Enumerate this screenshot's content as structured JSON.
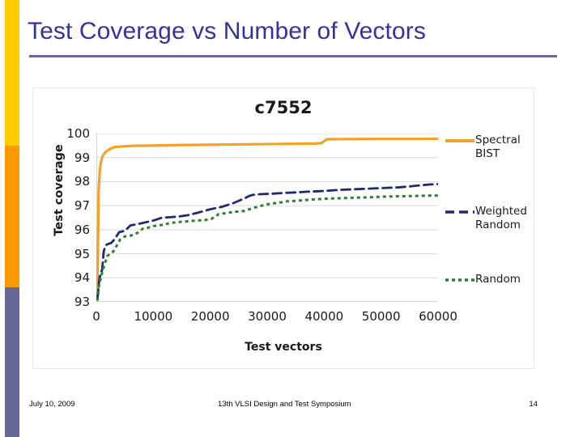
{
  "slide": {
    "title": "Test Coverage vs Number of Vectors",
    "accent_yellow": "#FFCC00",
    "accent_orange": "#FF9900",
    "accent_purple": "#666699",
    "title_color": "#333399"
  },
  "footer": {
    "date": "July 10, 2009",
    "event": "13th VLSI Design and Test Symposium",
    "page_number": "14"
  },
  "chart_data": {
    "type": "line",
    "title": "c7552",
    "xlabel": "Test vectors",
    "ylabel": "Test coverage",
    "xlim": [
      0,
      60000
    ],
    "ylim": [
      93,
      100
    ],
    "xticks": [
      0,
      10000,
      20000,
      30000,
      40000,
      50000,
      60000
    ],
    "xtick_labels": [
      "0",
      "10000",
      "20000",
      "30000",
      "40000",
      "50000",
      "60000"
    ],
    "yticks": [
      93,
      94,
      95,
      96,
      97,
      98,
      99,
      100
    ],
    "ytick_labels": [
      "93",
      "94",
      "95",
      "96",
      "97",
      "98",
      "99",
      "100"
    ],
    "grid": "horizontal",
    "legend_position": "right",
    "series": [
      {
        "name": "Spectral BIST",
        "legend_label": "Spectral\nBIST",
        "color": "#F0A22E",
        "style": "solid",
        "x": [
          0,
          200,
          400,
          600,
          800,
          1000,
          1200,
          1500,
          2000,
          2600,
          3200,
          4000,
          5000,
          7000,
          10000,
          14000,
          18000,
          22000,
          26000,
          30000,
          34000,
          38000,
          39500,
          40500,
          44000,
          50000,
          56000,
          60000
        ],
        "y": [
          93.05,
          93.6,
          97.6,
          98.45,
          98.8,
          99.0,
          99.1,
          99.2,
          99.3,
          99.38,
          99.44,
          99.45,
          99.47,
          99.49,
          99.5,
          99.52,
          99.53,
          99.54,
          99.55,
          99.56,
          99.57,
          99.58,
          99.6,
          99.76,
          99.77,
          99.78,
          99.78,
          99.78
        ]
      },
      {
        "name": "Weighted Random",
        "legend_label": "Weighted\nRandom",
        "color": "#1F2A6E",
        "style": "dashed",
        "x": [
          200,
          500,
          800,
          1000,
          1300,
          1600,
          2000,
          2600,
          3200,
          4000,
          5000,
          6000,
          7000,
          8500,
          10000,
          11500,
          13000,
          14500,
          16000,
          18000,
          20000,
          22000,
          24000,
          26000,
          26800,
          27500,
          29000,
          31000,
          33000,
          35000,
          37000,
          39000,
          41000,
          43000,
          45000,
          47000,
          49000,
          51000,
          53000,
          55000,
          57000,
          58500,
          60000
        ],
        "y": [
          93.15,
          93.9,
          94.25,
          94.3,
          95.1,
          95.35,
          95.4,
          95.45,
          95.6,
          95.9,
          95.95,
          96.18,
          96.22,
          96.3,
          96.38,
          96.5,
          96.52,
          96.55,
          96.6,
          96.72,
          96.85,
          96.95,
          97.1,
          97.3,
          97.4,
          97.45,
          97.48,
          97.5,
          97.53,
          97.55,
          97.58,
          97.6,
          97.63,
          97.66,
          97.68,
          97.7,
          97.72,
          97.74,
          97.76,
          97.8,
          97.85,
          97.88,
          97.9
        ]
      },
      {
        "name": "Random",
        "legend_label": "Random",
        "color": "#2E7D32",
        "style": "dotted",
        "x": [
          200,
          500,
          800,
          1100,
          1500,
          1900,
          2400,
          3000,
          3600,
          4200,
          5000,
          5800,
          6600,
          7400,
          8200,
          9000,
          10000,
          11500,
          13000,
          14500,
          16000,
          17500,
          19000,
          20200,
          21500,
          23000,
          24500,
          26000,
          27500,
          29000,
          30500,
          32000,
          33500,
          35000,
          37000,
          39000,
          41000,
          43000,
          45000,
          47000,
          49000,
          51000,
          53000,
          55000,
          57000,
          58500,
          60000
        ],
        "y": [
          93.05,
          93.75,
          94.0,
          94.3,
          94.6,
          94.9,
          95.0,
          95.1,
          95.35,
          95.6,
          95.72,
          95.75,
          95.78,
          95.9,
          96.05,
          96.08,
          96.15,
          96.2,
          96.28,
          96.32,
          96.35,
          96.38,
          96.4,
          96.45,
          96.65,
          96.7,
          96.75,
          96.78,
          96.9,
          97.0,
          97.08,
          97.12,
          97.18,
          97.2,
          97.24,
          97.27,
          97.3,
          97.31,
          97.33,
          97.34,
          97.36,
          97.38,
          97.39,
          97.4,
          97.41,
          97.42,
          97.42
        ]
      }
    ]
  }
}
